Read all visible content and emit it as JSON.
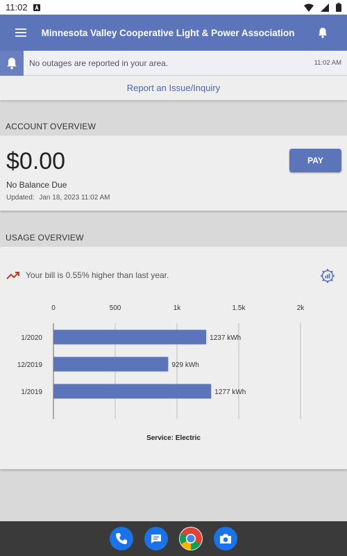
{
  "status_bar": {
    "time": "11:02"
  },
  "app_bar": {
    "title": "Minnesota Valley Cooperative Light & Power Association"
  },
  "notice": {
    "message": "No outages are reported in your area.",
    "time": "11:02 AM"
  },
  "report_link": "Report an Issue/Inquiry",
  "account": {
    "section_label": "ACCOUNT OVERVIEW",
    "balance": "$0.00",
    "status": "No Balance Due",
    "updated_label": "Updated:",
    "updated_value": "Jan 18, 2023 11:02 AM",
    "pay_label": "PAY"
  },
  "usage": {
    "section_label": "USAGE OVERVIEW",
    "trend_text": "Your bill is 0.55% higher than last year.",
    "service_label": "Service: Electric"
  },
  "colors": {
    "brand": "#5c74ba",
    "bar": "#5c74ba",
    "trend": "#c0392b"
  },
  "chart_data": {
    "type": "bar",
    "orientation": "horizontal",
    "categories": [
      "1/2020",
      "12/2019",
      "1/2019"
    ],
    "values": [
      1237,
      929,
      1277
    ],
    "value_labels": [
      "1237 kWh",
      "929 kWh",
      "1277 kWh"
    ],
    "xlim": [
      0,
      2000
    ],
    "ticks": [
      0,
      500,
      1000,
      1500,
      2000
    ],
    "tick_labels": [
      "0",
      "500",
      "1k",
      "1.5k",
      "2k"
    ],
    "grid": true
  }
}
